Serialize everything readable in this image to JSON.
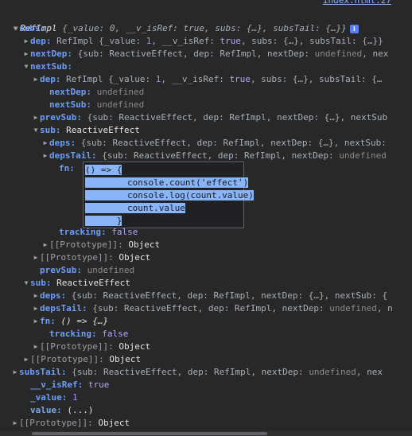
{
  "source_link": "index.html:27",
  "root": {
    "name": "RefImpl",
    "preview": "{_value: 0, __v_isRef: true, subs: {…}, subsTail: {…}}",
    "info_badge": "i"
  },
  "lines": [
    {
      "key": "subs",
      "sep": ":",
      "rest": ""
    },
    {
      "key": "dep",
      "sep": ":",
      "rest": " RefImpl {_value: 1, __v_isRef: true, subs: {…}, subsTail: {…}}"
    },
    {
      "key": "nextDep",
      "sep": ":",
      "rest": " {sub: ReactiveEffect, dep: RefImpl, nextDep: undefined, nex"
    },
    {
      "key": "nextSub",
      "sep": ":",
      "rest": ""
    },
    {
      "key": "dep",
      "sep": ":",
      "rest": " RefImpl {_value: 1, __v_isRef: true, subs: {…}, subsTail: {…"
    },
    {
      "key": "nextDep",
      "sep": ":",
      "rest": " undefined"
    },
    {
      "key": "nextSub",
      "sep": ":",
      "rest": " undefined"
    },
    {
      "key": "prevSub",
      "sep": ":",
      "rest": " {sub: ReactiveEffect, dep: RefImpl, nextDep: {…}, nextSub"
    },
    {
      "key": "sub",
      "sep": ":",
      "rest": " ReactiveEffect"
    },
    {
      "key": "deps",
      "sep": ":",
      "rest": " {sub: ReactiveEffect, dep: RefImpl, nextDep: {…}, nextSub:"
    },
    {
      "key": "depsTail",
      "sep": ":",
      "rest": " {sub: ReactiveEffect, dep: RefImpl, nextDep: undefined"
    },
    {
      "key": "fn",
      "sep": ":",
      "rest": ""
    },
    {
      "key": "tracking",
      "sep": ":",
      "rest": " false"
    },
    {
      "key": "[[Prototype]]",
      "sep": ":",
      "rest": " Object"
    },
    {
      "key": "[[Prototype]]",
      "sep": ":",
      "rest": " Object"
    },
    {
      "key": "prevSub",
      "sep": ":",
      "rest": " undefined"
    },
    {
      "key": "sub",
      "sep": ":",
      "rest": " ReactiveEffect"
    },
    {
      "key": "deps",
      "sep": ":",
      "rest": " {sub: ReactiveEffect, dep: RefImpl, nextDep: {…}, nextSub: {"
    },
    {
      "key": "depsTail",
      "sep": ":",
      "rest": " {sub: ReactiveEffect, dep: RefImpl, nextDep: undefined, n"
    },
    {
      "key": "fn",
      "sep": ":",
      "rest": " () => {…}"
    },
    {
      "key": "tracking",
      "sep": ":",
      "rest": " false"
    },
    {
      "key": "[[Prototype]]",
      "sep": ":",
      "rest": " Object"
    },
    {
      "key": "[[Prototype]]",
      "sep": ":",
      "rest": " Object"
    },
    {
      "key": "subsTail",
      "sep": ":",
      "rest": " {sub: ReactiveEffect, dep: RefImpl, nextDep: undefined, nex"
    },
    {
      "key": "__v_isRef",
      "sep": ":",
      "rest": " true"
    },
    {
      "key": "_value",
      "sep": ":",
      "rest": " 1"
    },
    {
      "key": "value",
      "sep": ":",
      "rest": " (...)"
    },
    {
      "key": "[[Prototype]]",
      "sep": ":",
      "rest": " Object"
    }
  ],
  "tooltip": {
    "lines": [
      "() => {",
      "        console.count('effect')",
      "        console.log(count.value)",
      "        count.value",
      "      }"
    ]
  },
  "colors": {
    "background": "#282828",
    "key": "#6c9ef8",
    "keyword": "#b2a4ff",
    "selection": "#8ab4f8"
  }
}
